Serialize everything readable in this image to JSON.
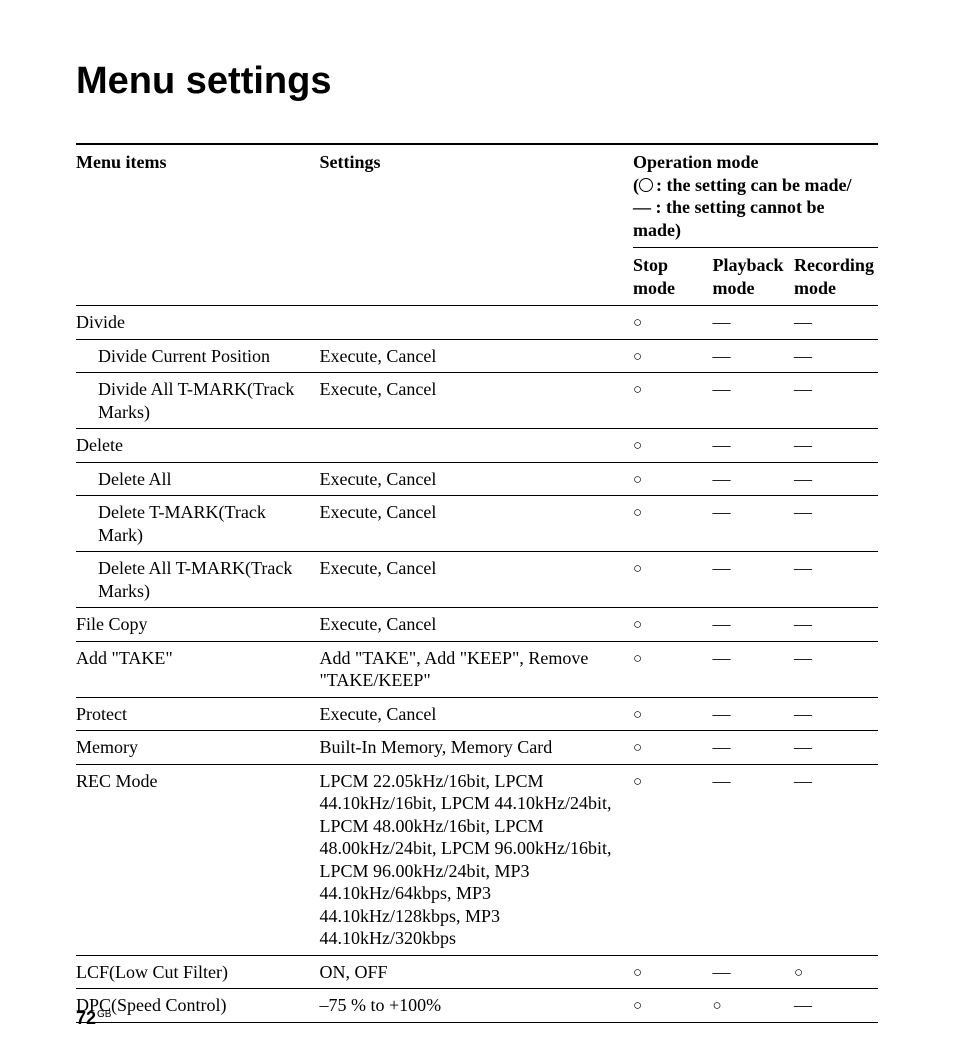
{
  "title": "Menu settings",
  "headers": {
    "menu_items": "Menu items",
    "settings": "Settings",
    "op_mode": "Operation mode",
    "legend_can": ": the setting can be made/",
    "legend_cannot": "— : the setting cannot be made)",
    "stop": "Stop mode",
    "playback": "Playback mode",
    "recording": "Recording mode"
  },
  "symbols": {
    "circle": "○",
    "dash": "—"
  },
  "rows": [
    {
      "item": "Divide",
      "indent": false,
      "settings": "",
      "stop": "○",
      "playback": "—",
      "recording": "—"
    },
    {
      "item": "Divide Current Position",
      "indent": true,
      "settings": "Execute, Cancel",
      "stop": "○",
      "playback": "—",
      "recording": "—"
    },
    {
      "item": "Divide All T-MARK(Track Marks)",
      "indent": true,
      "settings": "Execute, Cancel",
      "stop": "○",
      "playback": "—",
      "recording": "—"
    },
    {
      "item": "Delete",
      "indent": false,
      "settings": "",
      "stop": "○",
      "playback": "—",
      "recording": "—"
    },
    {
      "item": "Delete All",
      "indent": true,
      "settings": "Execute, Cancel",
      "stop": "○",
      "playback": "—",
      "recording": "—"
    },
    {
      "item": "Delete T-MARK(Track Mark)",
      "indent": true,
      "settings": "Execute, Cancel",
      "stop": "○",
      "playback": "—",
      "recording": "—"
    },
    {
      "item": "Delete All T-MARK(Track Marks)",
      "indent": true,
      "settings": "Execute, Cancel",
      "stop": "○",
      "playback": "—",
      "recording": "—"
    },
    {
      "item": "File Copy",
      "indent": false,
      "settings": "Execute,  Cancel",
      "stop": "○",
      "playback": "—",
      "recording": "—"
    },
    {
      "item": "Add \"TAKE\"",
      "indent": false,
      "settings": "Add \"TAKE\", Add \"KEEP\", Remove \"TAKE/KEEP\"",
      "stop": "○",
      "playback": "—",
      "recording": "—"
    },
    {
      "item": "Protect",
      "indent": false,
      "settings": "Execute, Cancel",
      "stop": "○",
      "playback": "—",
      "recording": "—"
    },
    {
      "item": "Memory",
      "indent": false,
      "settings": "Built-In Memory, Memory Card",
      "stop": "○",
      "playback": "—",
      "recording": "—"
    },
    {
      "item": "REC Mode",
      "indent": false,
      "settings": "LPCM 22.05kHz/16bit, LPCM 44.10kHz/16bit, LPCM 44.10kHz/24bit, LPCM 48.00kHz/16bit, LPCM 48.00kHz/24bit, LPCM 96.00kHz/16bit, LPCM 96.00kHz/24bit, MP3  44.10kHz/64kbps, MP3  44.10kHz/128kbps, MP3  44.10kHz/320kbps",
      "stop": "○",
      "playback": "—",
      "recording": "—"
    },
    {
      "item": "LCF(Low Cut Filter)",
      "indent": false,
      "settings": "ON, OFF",
      "stop": "○",
      "playback": "—",
      "recording": "○"
    },
    {
      "item": "DPC(Speed Control)",
      "indent": false,
      "settings": "–75 % to +100%",
      "stop": "○",
      "playback": "○",
      "recording": "—"
    }
  ],
  "footer": {
    "page": "72",
    "locale": "GB"
  }
}
